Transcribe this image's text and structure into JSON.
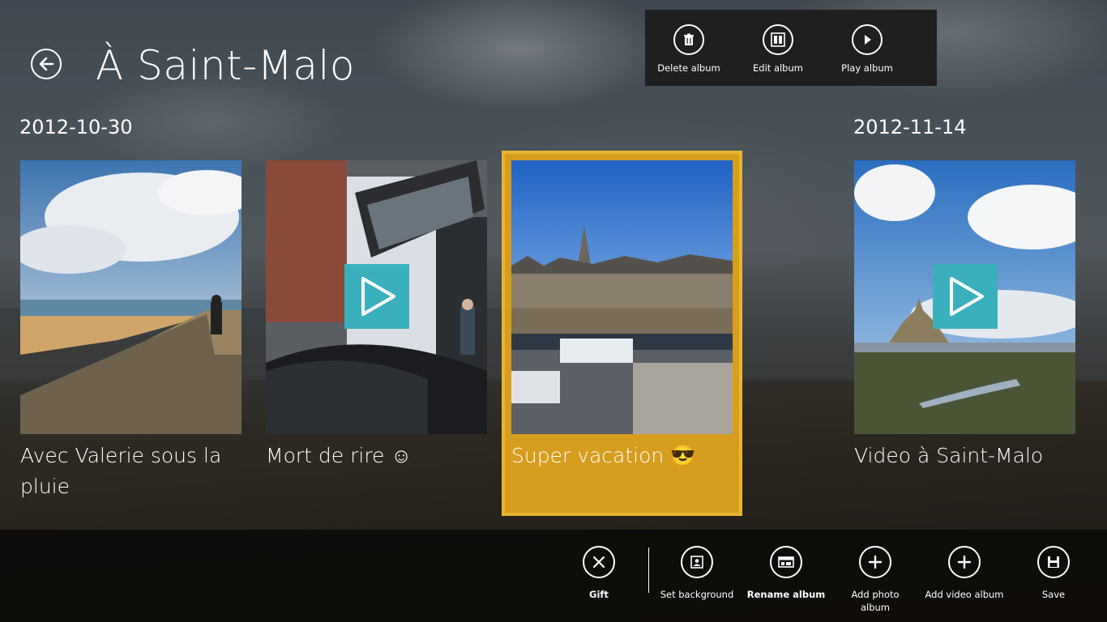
{
  "header": {
    "title": "À Saint-Malo"
  },
  "top_commands": [
    {
      "label": "Delete album",
      "icon": "trash-icon"
    },
    {
      "label": "Edit album",
      "icon": "edit-album-icon"
    },
    {
      "label": "Play album",
      "icon": "play-icon"
    }
  ],
  "groups": [
    {
      "date": "2012-10-30"
    },
    {
      "date": "2012-11-14"
    }
  ],
  "tiles": [
    {
      "caption": "Avec Valerie sous la pluie",
      "is_video": false
    },
    {
      "caption": "Mort de rire ☺",
      "is_video": true
    },
    {
      "caption": "Super vacation 😎",
      "is_video": false,
      "selected": true
    },
    {
      "caption": "Video à Saint-Malo",
      "is_video": true
    }
  ],
  "bottom_commands": [
    {
      "label": "Gift",
      "icon": "close-x-icon"
    },
    {
      "label": "Set background",
      "icon": "set-background-icon"
    },
    {
      "label": "Rename album",
      "icon": "rename-icon"
    },
    {
      "label": "Add photo album",
      "icon": "plus-icon"
    },
    {
      "label": "Add video album",
      "icon": "plus-icon"
    },
    {
      "label": "Save",
      "icon": "save-icon"
    }
  ],
  "colors": {
    "selection": "#d69d1e",
    "play_badge": "#3ab0bd",
    "app_bar": "#1f1f1f"
  }
}
